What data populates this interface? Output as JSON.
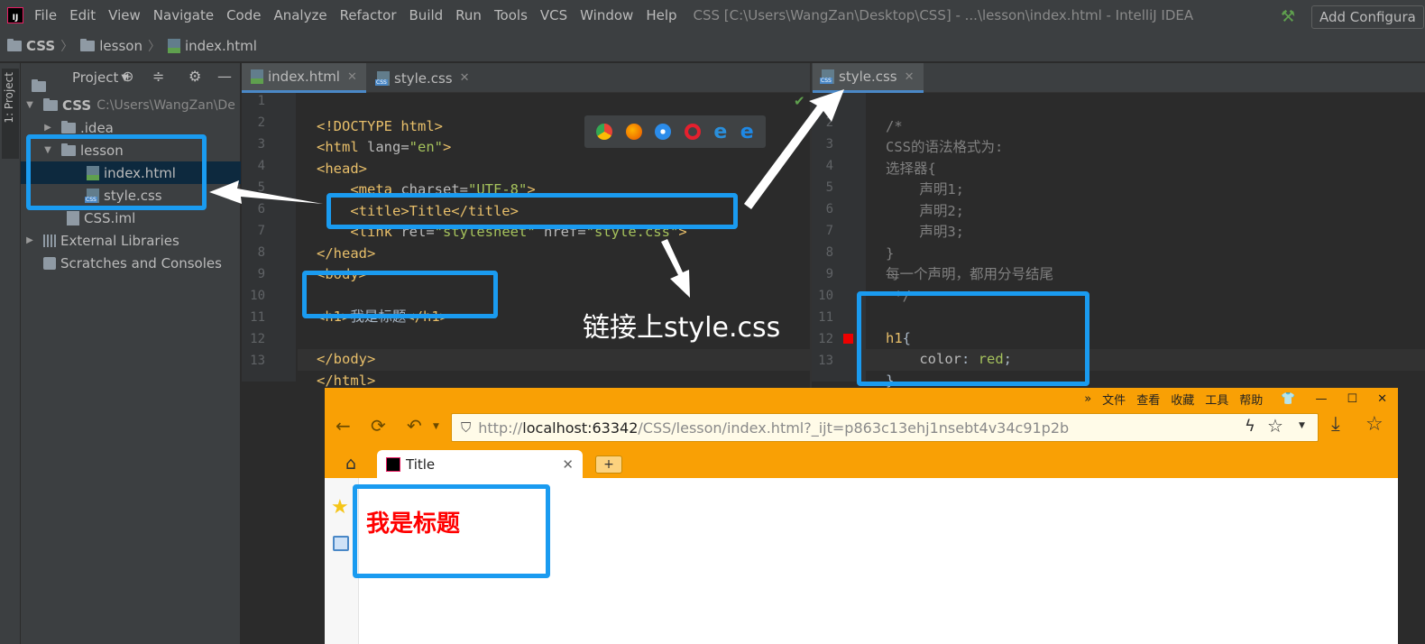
{
  "menubar": {
    "items": [
      "File",
      "Edit",
      "View",
      "Navigate",
      "Code",
      "Analyze",
      "Refactor",
      "Build",
      "Run",
      "Tools",
      "VCS",
      "Window",
      "Help"
    ],
    "title": "CSS [C:\\Users\\WangZan\\Desktop\\CSS] - ...\\lesson\\index.html - IntelliJ IDEA"
  },
  "navbar": {
    "crumbs": [
      "CSS",
      "lesson",
      "index.html"
    ],
    "add_config": "Add Configura"
  },
  "stripe": {
    "label": "1: Project"
  },
  "project": {
    "title": "Project",
    "root_name": "CSS",
    "root_path": "C:\\Users\\WangZan\\De",
    "idea": ".idea",
    "lesson": "lesson",
    "index_html": "index.html",
    "style_css": "style.css",
    "css_iml": "CSS.iml",
    "external": "External Libraries",
    "scratches": "Scratches and Consoles"
  },
  "tabs_left": [
    "index.html",
    "style.css"
  ],
  "tabs_right": [
    "style.css"
  ],
  "html_code": {
    "l1": "<!DOCTYPE html>",
    "l2a": "<html",
    "l2b": " lang=",
    "l2c": "\"en\"",
    "l2d": ">",
    "l3": "<head>",
    "l4a": "    <meta",
    "l4b": " charset=",
    "l4c": "\"UTF-8\"",
    "l4d": ">",
    "l5": "    <title>Title</title>",
    "l6a": "    <link",
    "l6b": " rel=",
    "l6c": "\"stylesheet\"",
    "l6d": " href=",
    "l6e": "\"style.css\"",
    "l6f": ">",
    "l7": "</head>",
    "l8": "<body>",
    "l10a": "<h1>",
    "l10b": "我是标题",
    "l10c": "</h1>",
    "l12": "</body>",
    "l13": "</html>"
  },
  "css_code": {
    "l1": "/*",
    "l2": "CSS的语法格式为:",
    "l3": "选择器{",
    "l4": "    声明1;",
    "l5": "    声明2;",
    "l6": "    声明3;",
    "l7": "}",
    "l8": "每一个声明，都用分号结尾",
    "l9": " */",
    "l11a": "h1",
    "l11b": "{",
    "l12a": "    color",
    "l12b": ": ",
    "l12c": "red",
    "l12d": ";",
    "l13": "}"
  },
  "line_numbers": [
    "1",
    "2",
    "3",
    "4",
    "5",
    "6",
    "7",
    "8",
    "9",
    "10",
    "11",
    "12",
    "13"
  ],
  "annotation": "链接上style.css",
  "browser": {
    "menu": [
      "»",
      "文件",
      "查看",
      "收藏",
      "工具",
      "帮助"
    ],
    "url_pre": "http://",
    "url_host": "localhost:63342",
    "url_path": "/CSS/lesson/index.html?_ijt=p863c13ehj1nsebt4v34c91p2b",
    "tab_title": "Title",
    "newtab": "+",
    "page_h1": "我是标题"
  },
  "colors": {
    "highlight": "#1a9bf0",
    "browser_orange": "#f9a005",
    "h1_red": "#ff0000"
  }
}
